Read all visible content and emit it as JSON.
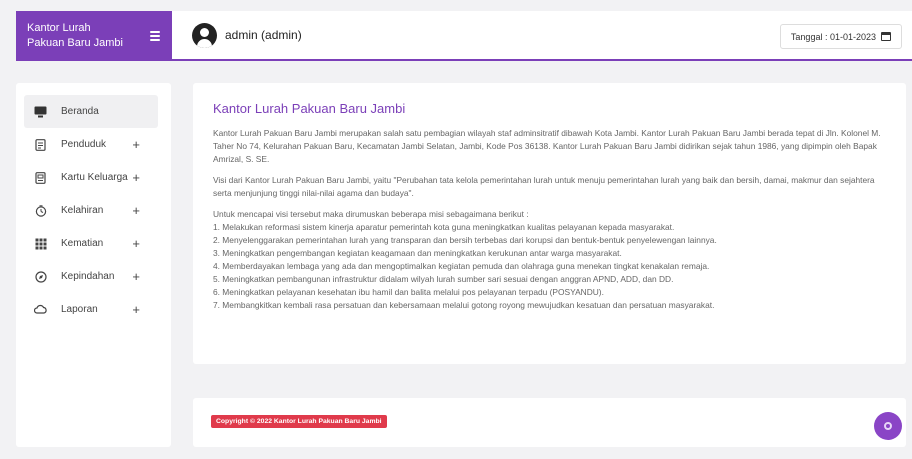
{
  "brand": {
    "title_line1": "Kantor Lurah",
    "title_line2": "Pakuan Baru Jambi"
  },
  "header": {
    "user": "admin (admin)",
    "date": "Tanggal : 01-01-2023"
  },
  "sidebar": {
    "items": [
      {
        "label": "Beranda",
        "icon": "monitor-icon",
        "expandable": false
      },
      {
        "label": "Penduduk",
        "icon": "document-icon",
        "expandable": true
      },
      {
        "label": "Kartu Keluarga",
        "icon": "card-icon",
        "expandable": true
      },
      {
        "label": "Kelahiran",
        "icon": "clock-icon",
        "expandable": true
      },
      {
        "label": "Kematian",
        "icon": "grid-icon",
        "expandable": true
      },
      {
        "label": "Kepindahan",
        "icon": "compass-icon",
        "expandable": true
      },
      {
        "label": "Laporan",
        "icon": "cloud-icon",
        "expandable": true
      }
    ]
  },
  "content": {
    "title": "Kantor Lurah Pakuan Baru Jambi",
    "intro": "Kantor Lurah Pakuan Baru Jambi merupakan salah satu pembagian wilayah staf adminsitratif dibawah Kota Jambi. Kantor Lurah Pakuan Baru Jambi berada tepat di Jln. Kolonel M. Taher No 74, Kelurahan Pakuan Baru, Kecamatan Jambi Selatan, Jambi, Kode Pos 36138. Kantor Lurah Pakuan Baru Jambi didirikan sejak tahun 1986, yang dipimpin oleh Bapak Amrizal, S. SE.",
    "vision": "Visi dari Kantor Lurah Pakuan Baru Jambi, yaitu \"Perubahan tata kelola pemerintahan lurah untuk menuju pemerintahan lurah yang baik dan bersih, damai, makmur dan sejahtera serta menjunjung tinggi nilai-nilai agama dan budaya\".",
    "mission_intro": "Untuk mencapai visi tersebut maka dirumuskan beberapa misi sebagaimana berikut :",
    "missions": [
      "1. Melakukan reformasi sistem kinerja aparatur pemerintah kota guna meningkatkan kualitas pelayanan kepada masyarakat.",
      "2. Menyelenggarakan pemerintahan lurah yang transparan dan bersih terbebas dari korupsi dan bentuk-bentuk penyelewengan lainnya.",
      "3. Meningkatkan pengembangan kegiatan keagamaan dan meningkatkan kerukunan antar warga masyarakat.",
      "4. Memberdayakan lembaga yang ada dan mengoptimalkan kegiatan pemuda dan olahraga guna menekan tingkat kenakalan remaja.",
      "5. Meningkatkan pembangunan infrastruktur didalam wilyah lurah sumber sari sesuai dengan anggran APND, ADD, dan DD.",
      "6. Meningkatkan pelayanan kesehatan ibu hamil dan balita melalui pos pelayanan terpadu (POSYANDU).",
      "7. Membangkitkan kembali rasa persatuan dan kebersamaan melalui gotong royong mewujudkan kesatuan dan persatuan masyarakat."
    ]
  },
  "footer": {
    "copyright": "Copyright © 2022 Kantor Lurah Pakuan Baru Jambi"
  },
  "colors": {
    "accent": "#7b3fb8",
    "badge": "#e03a4b"
  }
}
